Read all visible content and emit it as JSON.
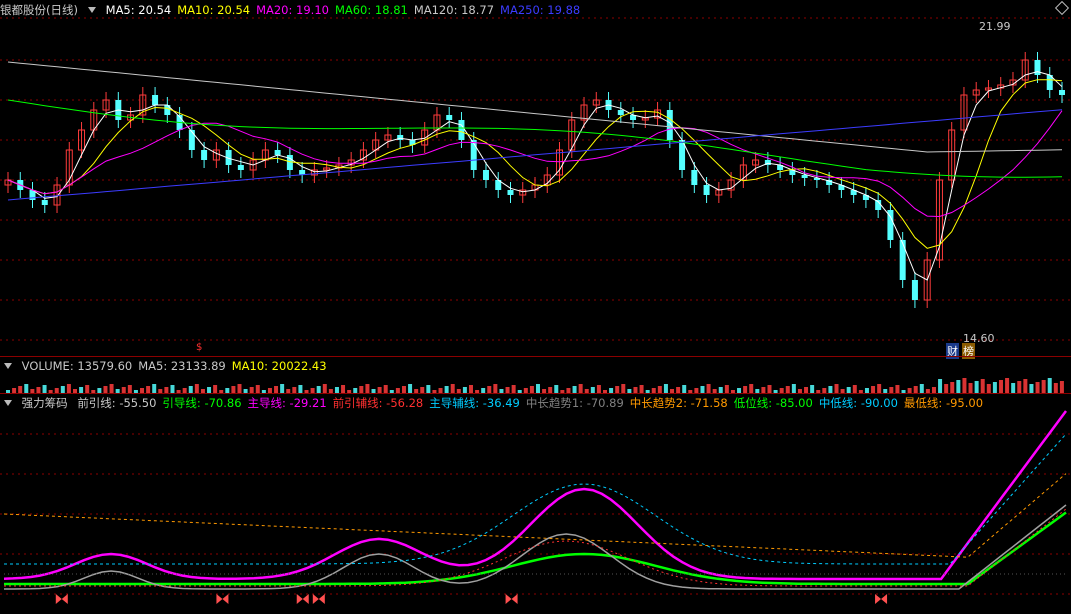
{
  "price_panel": {
    "title": "银都股份(日线)",
    "ma_labels": [
      {
        "text": "MA5: 20.54",
        "color": "#ffffff"
      },
      {
        "text": "MA10: 20.54",
        "color": "#ffff00"
      },
      {
        "text": "MA20: 19.10",
        "color": "#ff00ff"
      },
      {
        "text": "MA60: 18.81",
        "color": "#00ff00"
      },
      {
        "text": "MA120: 18.77",
        "color": "#c8c8c8"
      },
      {
        "text": "MA250: 19.88",
        "color": "#3c3cff"
      }
    ],
    "high_label": "21.99",
    "low_label": "14.60",
    "badges": [
      {
        "text": "财",
        "color": "#ffffff",
        "bg": "#1a3a8a"
      },
      {
        "text": "榜",
        "color": "#ffffff",
        "bg": "#8a5a00"
      }
    ],
    "marker": "$"
  },
  "volume_panel": {
    "labels": [
      {
        "text": "VOLUME: 13579.60",
        "color": "#c8c8c8"
      },
      {
        "text": "MA5: 23133.89",
        "color": "#c8c8c8"
      },
      {
        "text": "MA10: 20022.43",
        "color": "#ffff00"
      }
    ]
  },
  "indicator_panel": {
    "title": "强力筹码",
    "labels": [
      {
        "text": "前引线: -55.50",
        "color": "#c8c8c8"
      },
      {
        "text": "引导线: -70.86",
        "color": "#00ff00"
      },
      {
        "text": "主导线: -29.21",
        "color": "#ff00ff"
      },
      {
        "text": "前引辅线: -56.28",
        "color": "#ff3030"
      },
      {
        "text": "主导辅线: -36.49",
        "color": "#00ccff"
      },
      {
        "text": "中长趋势1: -70.89",
        "color": "#808080"
      },
      {
        "text": "中长趋势2: -71.58",
        "color": "#ff9900"
      },
      {
        "text": "低位线: -85.00",
        "color": "#00ff00"
      },
      {
        "text": "中低线: -90.00",
        "color": "#00ccff"
      },
      {
        "text": "最低线: -95.00",
        "color": "#ff9900"
      }
    ]
  },
  "colors": {
    "up": "#ff3c3c",
    "down": "#54ffff",
    "grid": "#8b0000"
  }
}
